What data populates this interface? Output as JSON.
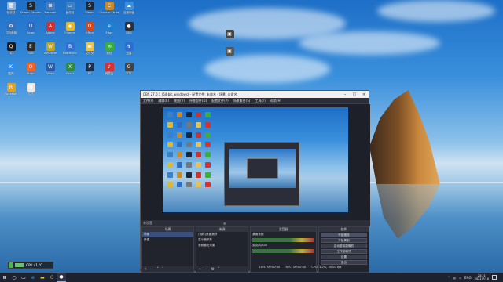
{
  "desktop": {
    "icons": [
      {
        "label": "回收站",
        "color": "#8fb0d0",
        "glyph": "🗑"
      },
      {
        "label": "Steam Sandbox",
        "color": "#1b2838",
        "glyph": "S"
      },
      {
        "label": "Network",
        "color": "#4a7ab8",
        "glyph": "⊞"
      },
      {
        "label": "此电脑",
        "color": "#3a80c8",
        "glyph": "▭"
      },
      {
        "label": "Steam",
        "color": "#1b2838",
        "glyph": "S"
      },
      {
        "label": "Counter-Strike",
        "color": "#c48a2c",
        "glyph": "C"
      },
      {
        "label": "百度网盘",
        "color": "#3b8fe0",
        "glyph": "☁"
      },
      {
        "label": "控制面板",
        "color": "#3a6fb0",
        "glyph": "⚙"
      },
      {
        "label": "Uplay",
        "color": "#2d6cc1",
        "glyph": "U"
      },
      {
        "label": "Adobe",
        "color": "#d4302a",
        "glyph": "A"
      },
      {
        "label": "Chrome",
        "color": "#e0b830",
        "glyph": "◉"
      },
      {
        "label": "Office",
        "color": "#d04a20",
        "glyph": "O"
      },
      {
        "label": "Edge",
        "color": "#1d7fd1",
        "glyph": "e"
      },
      {
        "label": "OBS",
        "color": "#303030",
        "glyph": "●"
      },
      {
        "label": "QQ",
        "color": "#1a1a1a",
        "glyph": "Q"
      },
      {
        "label": "Epic",
        "color": "#2a2a2a",
        "glyph": "E"
      },
      {
        "label": "WeGame",
        "color": "#c3a020",
        "glyph": "W"
      },
      {
        "label": "Battle.net",
        "color": "#2e6fd0",
        "glyph": "B"
      },
      {
        "label": "文件夹",
        "color": "#e8c24a",
        "glyph": "▬"
      },
      {
        "label": "微信",
        "color": "#3aaf3a",
        "glyph": "✉"
      },
      {
        "label": "迅雷",
        "color": "#2a6fd8",
        "glyph": "↯"
      },
      {
        "label": "酷狗",
        "color": "#2d8cf0",
        "glyph": "K"
      },
      {
        "label": "Origin",
        "color": "#f0642a",
        "glyph": "O"
      },
      {
        "label": "Word",
        "color": "#2a5aa8",
        "glyph": "W"
      },
      {
        "label": "Excel",
        "color": "#2f8a4a",
        "glyph": "X"
      },
      {
        "label": "PS",
        "color": "#1a3050",
        "glyph": "P"
      },
      {
        "label": "网易云",
        "color": "#d63030",
        "glyph": "♪"
      },
      {
        "label": "GTA",
        "color": "#444",
        "glyph": "G"
      },
      {
        "label": "Rockstar",
        "color": "#e0a020",
        "glyph": "R"
      },
      {
        "label": "文档",
        "color": "#e8e8e8",
        "glyph": "▤"
      }
    ]
  },
  "obs": {
    "title": "OBS 27.0.1 (64-bit, windows) - 配置文件: 未命名 - 场景: 未命名",
    "menu": [
      "文件(F)",
      "编辑(E)",
      "视图(V)",
      "停靠部件(D)",
      "配置文件(P)",
      "场景集合(S)",
      "工具(T)",
      "帮助(H)"
    ],
    "scene_label": "未设置",
    "docks": {
      "scenes": {
        "header": "场景",
        "items": [
          "场景",
          "新建"
        ]
      },
      "sources": {
        "header": "来源",
        "items": [
          "(远程)桌面捕获",
          "显示器采集",
          "音频输出采集"
        ]
      },
      "mixer": {
        "header": "混音器",
        "tracks": [
          "桌面音频",
          "麦克风/Aux"
        ]
      },
      "controls": {
        "header": "控件",
        "buttons": [
          "开始推流",
          "开始录制",
          "启动虚拟摄像机",
          "工作室模式",
          "设置",
          "退出"
        ]
      }
    },
    "status": {
      "live": "LIVE: 00:00:00",
      "rec": "REC: 00:00:00",
      "cpu": "CPU: 1.2%, 30.00 fps"
    }
  },
  "perf_widget": {
    "text": "GPU 41 °C",
    "level": 0.35
  },
  "taskbar": {
    "items": [
      "start",
      "search",
      "taskview",
      "edge",
      "explorer",
      "counter-strike",
      "obs"
    ],
    "tray": {
      "lang": "ENG",
      "time": "23:21",
      "date": "2021/7/10"
    }
  }
}
